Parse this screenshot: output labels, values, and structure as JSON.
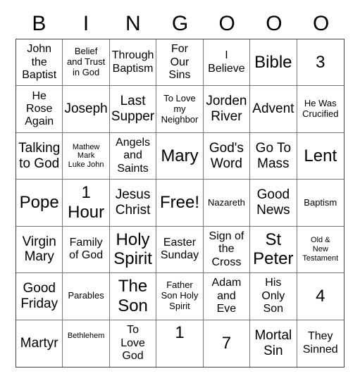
{
  "header": {
    "letters": [
      "B",
      "I",
      "N",
      "G",
      "O",
      "O",
      "O"
    ]
  },
  "cells": [
    [
      "John\nthe\nBaptist",
      "Belief\nand Trust\nin God",
      "Through\nBaptism",
      "For\nOur\nSins",
      "I\nBelieve",
      "Bible",
      "3"
    ],
    [
      "He\nRose\nAgain",
      "Joseph",
      "Last\nSupper",
      "To Love\nmy\nNeighbor",
      "Jorden\nRiver",
      "Advent",
      "He Was\nCrucified"
    ],
    [
      "Talking\nto God",
      "Mathew\nMark\nLuke John",
      "Angels\nand\nSaints",
      "Mary",
      "God's\nWord",
      "Go To\nMass",
      "Lent"
    ],
    [
      "Pope",
      "1\nHour",
      "Jesus\nChrist",
      "Free!",
      "Nazareth",
      "Good\nNews",
      "Baptism"
    ],
    [
      "Virgin\nMary",
      "Family\nof God",
      "Holy\nSpirit",
      "Easter\nSunday",
      "Sign of\nthe\nCross",
      "St\nPeter",
      "Old &\nNew\nTestament"
    ],
    [
      "Good\nFriday",
      "Parables",
      "The\nSon",
      "Father\nSon Holy\nSpirit",
      "Adam\nand\nEve",
      "His\nOnly\nSon",
      "4"
    ],
    [
      "Martyr",
      "Bethlehem",
      "To\nLove\nGod",
      "1",
      "7",
      "Mortal\nSin",
      "They\nSinned"
    ]
  ]
}
